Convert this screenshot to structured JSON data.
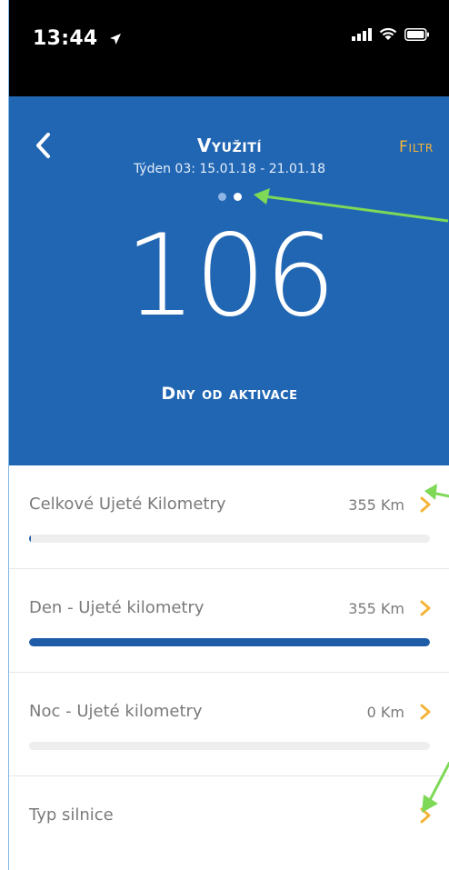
{
  "status_bar": {
    "time": "13:44",
    "icons": [
      "location-arrow-icon",
      "signal-icon",
      "wifi-icon",
      "battery-icon"
    ]
  },
  "header": {
    "title": "Využití",
    "subtitle": "Týden 03: 15.01.18 - 21.01.18",
    "filter_label": "Filtr",
    "back_icon": "chevron-left-icon"
  },
  "pager": {
    "count": 2,
    "active_index": 1
  },
  "hero": {
    "value": "106",
    "label": "Dny od aktivace"
  },
  "rows": [
    {
      "label": "Celkové Ujeté Kilometry",
      "value": "355 Km",
      "progress": 0.005
    },
    {
      "label": "Den - Ujeté kilometry",
      "value": "355 Km",
      "progress": 1.0
    },
    {
      "label": "Noc - Ujeté kilometry",
      "value": "0 Km",
      "progress": 0.0
    },
    {
      "label": "Typ silnice",
      "value": "",
      "progress": null
    }
  ],
  "colors": {
    "header_bg": "#2166b3",
    "accent": "#f4b43a",
    "bar_fill": "#1f5ca8",
    "bar_track": "#eeeeee",
    "annotation_arrow": "#7ed957"
  }
}
